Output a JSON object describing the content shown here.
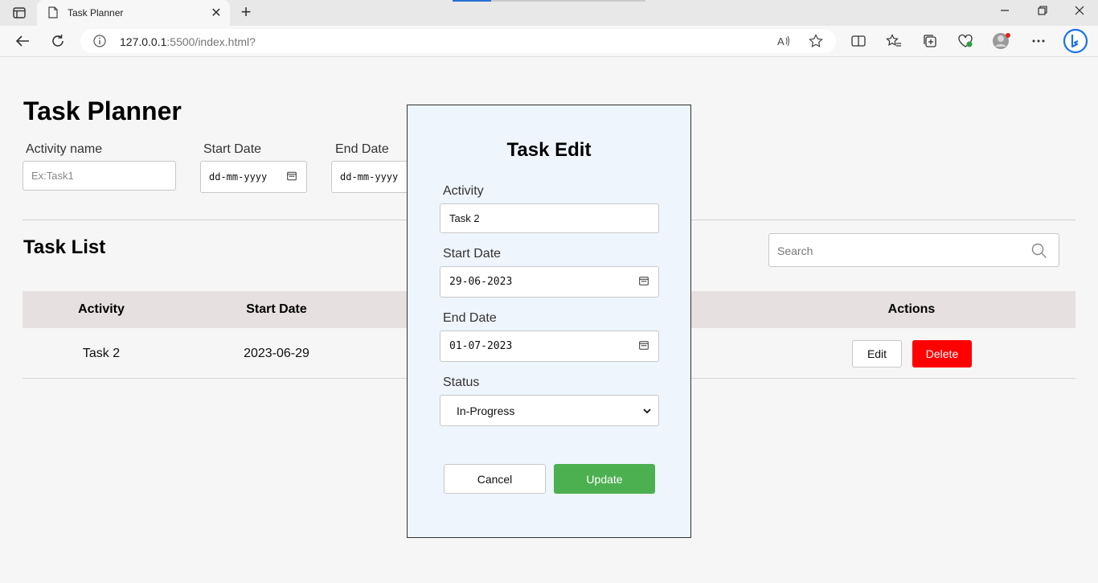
{
  "browser": {
    "tab_title": "Task Planner",
    "url_host": "127.0.0.1",
    "url_rest": ":5500/index.html?"
  },
  "page": {
    "title": "Task Planner",
    "form": {
      "activity_label": "Activity name",
      "activity_placeholder": "Ex:Task1",
      "start_label": "Start Date",
      "start_placeholder": "dd-mm-yyyy",
      "end_label": "End Date",
      "end_placeholder": "dd-mm-yyyy"
    },
    "list_title": "Task List",
    "search_placeholder": "Search",
    "table": {
      "headers": {
        "activity": "Activity",
        "start": "Start Date",
        "actions": "Actions"
      },
      "rows": [
        {
          "activity": "Task 2",
          "start": "2023-06-29",
          "edit_label": "Edit",
          "delete_label": "Delete"
        }
      ]
    }
  },
  "modal": {
    "title": "Task Edit",
    "activity_label": "Activity",
    "activity_value": "Task 2",
    "start_label": "Start Date",
    "start_value": "29-06-2023",
    "end_label": "End Date",
    "end_value": "01-07-2023",
    "status_label": "Status",
    "status_value": "In-Progress",
    "cancel_label": "Cancel",
    "update_label": "Update"
  },
  "colors": {
    "update": "#4caf50",
    "delete": "#ff0000",
    "modal_bg": "#eef5fc",
    "table_head": "#e6e0e0"
  }
}
